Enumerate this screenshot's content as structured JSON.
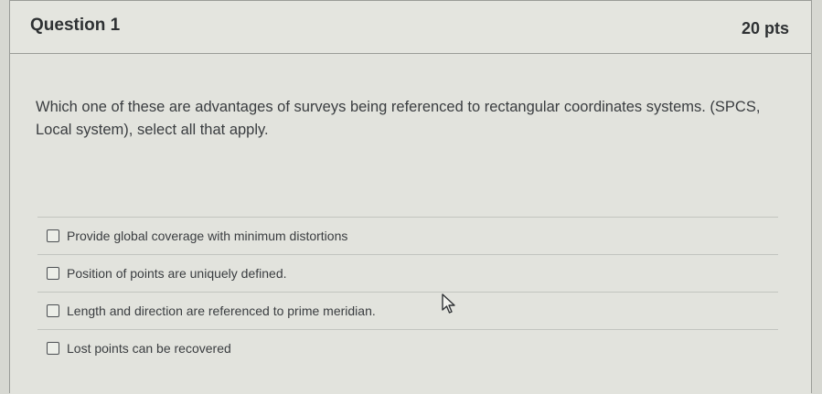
{
  "question": {
    "title": "Question 1",
    "points": "20 pts",
    "prompt": "Which one of these are advantages of surveys being referenced to rectangular coordinates systems. (SPCS, Local system), select all that apply."
  },
  "answers": [
    {
      "label": "Provide global coverage with minimum distortions",
      "checked": false
    },
    {
      "label": "Position of points are uniquely defined.",
      "checked": false
    },
    {
      "label": "Length and direction are referenced to prime meridian.",
      "checked": false
    },
    {
      "label": "Lost points can be recovered",
      "checked": false
    }
  ]
}
